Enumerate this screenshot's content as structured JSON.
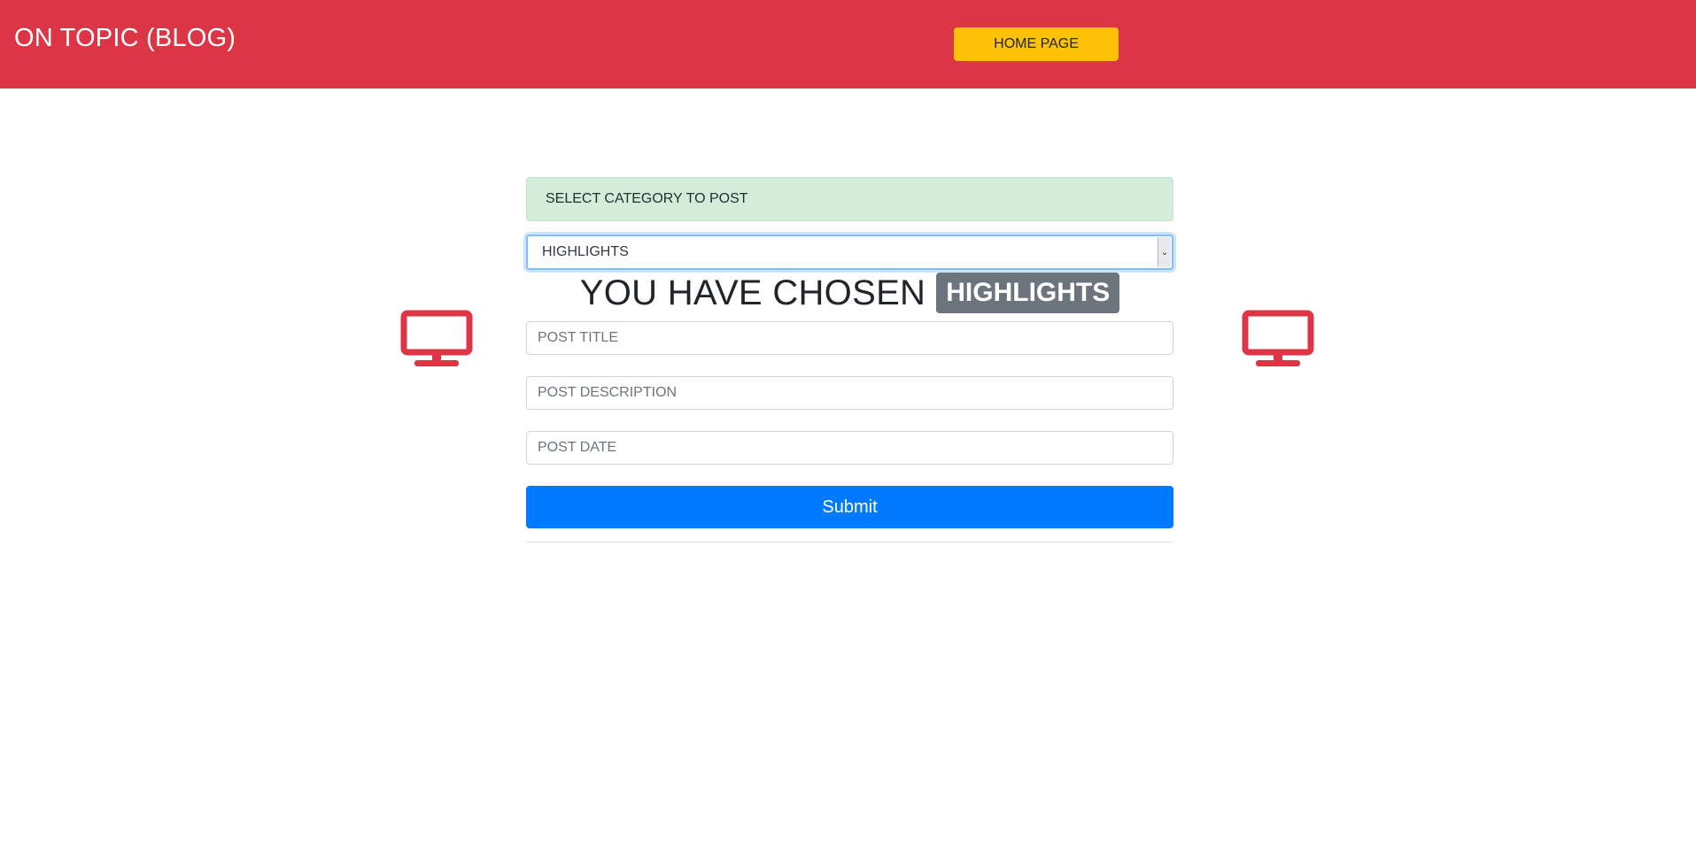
{
  "header": {
    "brand": "ON TOPIC (BLOG)",
    "home_label": "HOME PAGE"
  },
  "category": {
    "prompt": "SELECT CATEGORY TO POST",
    "selected": "HIGHLIGHTS",
    "chosen_prefix": "YOU HAVE CHOSEN",
    "chosen_badge": "HIGHLIGHTS"
  },
  "form": {
    "title_placeholder": "POST TITLE",
    "description_placeholder": "POST DESCRIPTION",
    "date_placeholder": "POST DATE",
    "submit_label": "Submit"
  },
  "icons": {
    "left": "monitor-icon",
    "right": "monitor-icon"
  },
  "colors": {
    "navbar": "#dc3545",
    "home_button": "#ffc107",
    "alert": "#d4edda",
    "badge": "#6c757d",
    "submit": "#007bff"
  }
}
